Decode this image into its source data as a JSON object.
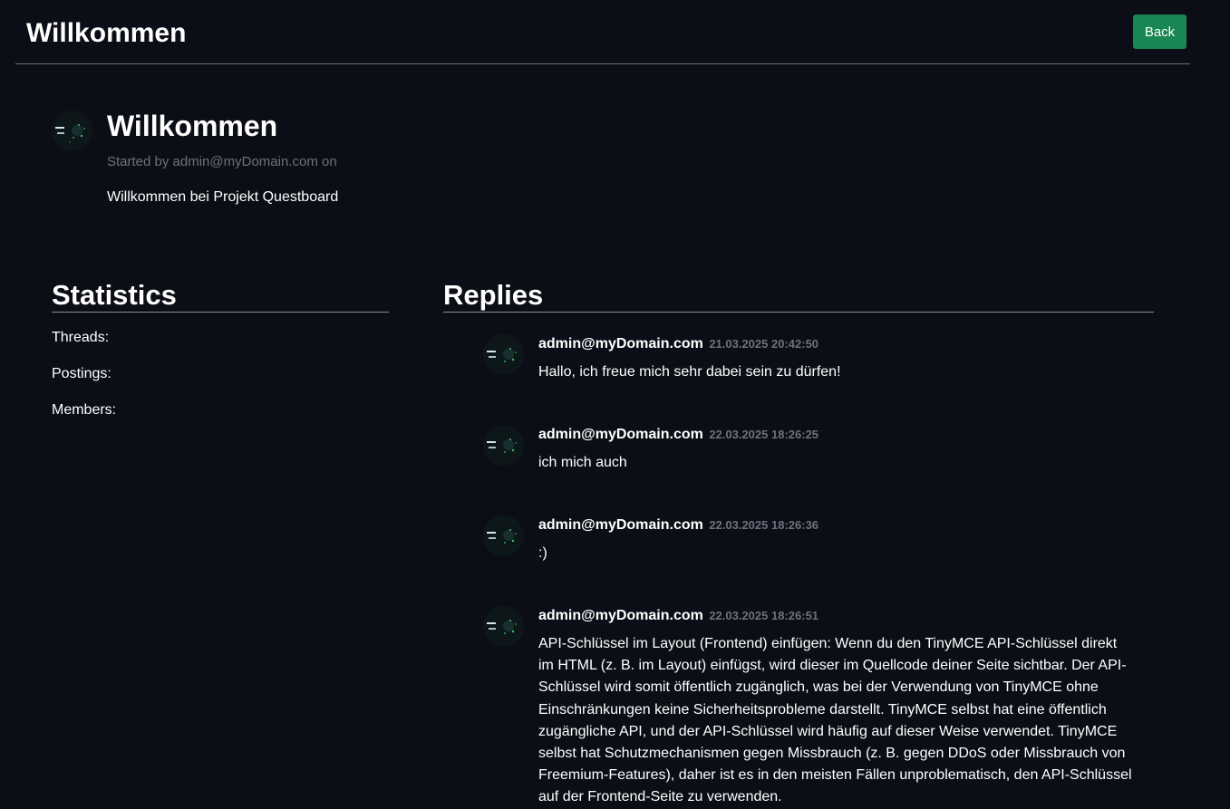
{
  "header": {
    "title": "Willkommen",
    "back_label": "Back"
  },
  "thread": {
    "avatar_icon": "user-avatar-icon",
    "title": "Willkommen",
    "meta": "Started by admin@myDomain.com on",
    "body": "Willkommen bei Projekt Questboard"
  },
  "statistics": {
    "heading": "Statistics",
    "items": [
      {
        "label": "Threads:"
      },
      {
        "label": "Postings:"
      },
      {
        "label": "Members:"
      }
    ]
  },
  "replies": {
    "heading": "Replies",
    "items": [
      {
        "author": "admin@myDomain.com",
        "date": "21.03.2025 20:42:50",
        "text": "Hallo, ich freue mich sehr dabei sein zu dürfen!"
      },
      {
        "author": "admin@myDomain.com",
        "date": "22.03.2025 18:26:25",
        "text": "ich mich auch"
      },
      {
        "author": "admin@myDomain.com",
        "date": "22.03.2025 18:26:36",
        "text": ":)"
      },
      {
        "author": "admin@myDomain.com",
        "date": "22.03.2025 18:26:51",
        "text": "API-Schlüssel im Layout (Frontend) einfügen: Wenn du den TinyMCE API-Schlüssel direkt im HTML (z. B. im Layout) einfügst, wird dieser im Quellcode deiner Seite sichtbar. Der API-Schlüssel wird somit öffentlich zugänglich, was bei der Verwendung von TinyMCE ohne Einschränkungen keine Sicherheitsprobleme darstellt. TinyMCE selbst hat eine öffentlich zugängliche API, und der API-Schlüssel wird häufig auf dieser Weise verwendet. TinyMCE selbst hat Schutzmechanismen gegen Missbrauch (z. B. gegen DDoS oder Missbrauch von Freemium-Features), daher ist es in den meisten Fällen unproblematisch, den API-Schlüssel auf der Frontend-Seite zu verwenden."
      }
    ]
  },
  "colors": {
    "background": "#0b0e16",
    "accent": "#198754",
    "muted_text": "#6c727c"
  }
}
